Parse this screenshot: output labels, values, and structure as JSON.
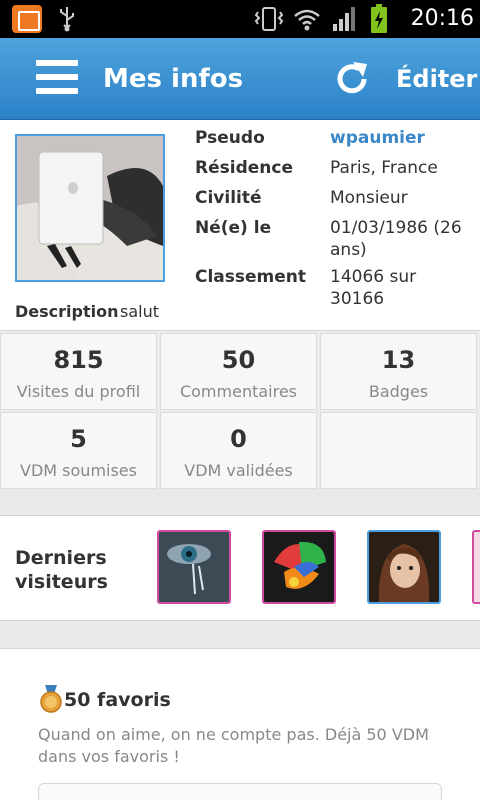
{
  "status_bar": {
    "time": "20:16",
    "icons": [
      "app-notification-icon",
      "usb-icon",
      "vibrate-icon",
      "wifi-icon",
      "signal-icon",
      "battery-charging-icon"
    ]
  },
  "header": {
    "title": "Mes infos",
    "edit_label": "Éditer",
    "menu_icon": "menu-icon",
    "refresh_icon": "refresh-icon",
    "color": "#3a8fd3"
  },
  "profile": {
    "fields": [
      {
        "label": "Pseudo",
        "value": "wpaumier"
      },
      {
        "label": "Résidence",
        "value": "Paris, France"
      },
      {
        "label": "Civilité",
        "value": "Monsieur"
      },
      {
        "label": "Né(e) le",
        "value": "01/03/1986 (26 ans)"
      },
      {
        "label": "Classement",
        "value": "14066 sur 30166"
      }
    ],
    "description_label": "Description",
    "description_value": "salut",
    "link_color": "#3b88c8"
  },
  "stats": [
    {
      "value": "815",
      "label": "Visites du profil"
    },
    {
      "value": "50",
      "label": "Commentaires"
    },
    {
      "value": "13",
      "label": "Badges"
    },
    {
      "value": "5",
      "label": "VDM soumises"
    },
    {
      "value": "0",
      "label": "VDM validées"
    }
  ],
  "visitors": {
    "title": "Derniers visiteurs"
  },
  "badge": {
    "icon": "medal-icon",
    "title": "50 favoris",
    "text": "Quand on aime, on ne compte pas. Déjà 50 VDM dans vos favoris !"
  }
}
